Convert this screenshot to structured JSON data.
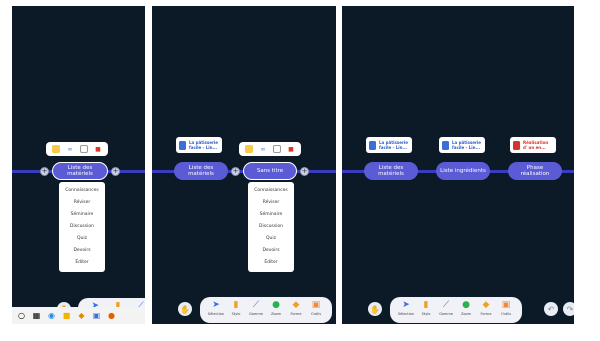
{
  "panel1": {
    "node_label": "Liste des matériels",
    "menu_items": [
      "Connaissances",
      "Réviser",
      "Séminaire",
      "Discussion",
      "Quiz",
      "Devoirs",
      "Éditer"
    ]
  },
  "panel2": {
    "node_label": "Liste des matériels",
    "card_text": "La pâtisserie facile - Lin...",
    "selected_node_label": "Sans titre",
    "menu_items": [
      "Connaissances",
      "Réviser",
      "Séminaire",
      "Discussion",
      "Quiz",
      "Devoirs",
      "Éditer"
    ],
    "dock_labels": [
      "Sélection",
      "Stylo",
      "Gomme",
      "Zoom",
      "Forme",
      "Outils"
    ]
  },
  "panel3": {
    "nodes": [
      "Liste des matériels",
      "Liste ingrédients",
      "Phase réalisation"
    ],
    "cards": [
      "La pâtisserie facile - Lin...",
      "La pâtisserie facile - Lin...",
      "Réalisation d' un en..."
    ],
    "dock_labels": [
      "Sélection",
      "Stylo",
      "Gomme",
      "Zoom",
      "Forme",
      "Outils"
    ]
  },
  "colors": {
    "background": "#0b1a26",
    "node": "#5b5bd6",
    "line": "#3b3bbf",
    "card_text_blue": "#2d58c8",
    "card_text_red": "#d3342b"
  },
  "icons": {
    "dock": [
      "cursor-icon",
      "pen-icon",
      "eraser-icon",
      "zoom-icon",
      "shape-icon",
      "tools-icon"
    ]
  }
}
